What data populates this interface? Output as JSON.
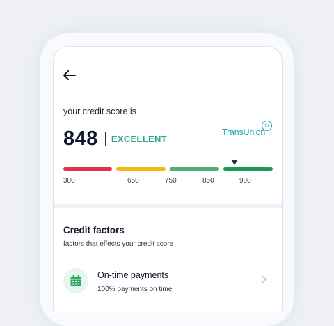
{
  "header": {
    "back_icon": "arrow-left-icon"
  },
  "score": {
    "label": "your credit score is",
    "value": "848",
    "rating": "EXCELLENT",
    "bureau": "TransUnion",
    "bureau_badge": "tu",
    "scale_ticks": [
      "300",
      "650",
      "750",
      "850",
      "900"
    ],
    "range_colors": [
      "#e4314a",
      "#f7b919",
      "#4caf79",
      "#1a9a56"
    ]
  },
  "factors": {
    "title": "Credit factors",
    "subtitle": "factors that effects your credit score",
    "items": [
      {
        "icon": "calendar-icon",
        "title": "On-time payments",
        "subtitle": "100% payments on time"
      }
    ]
  }
}
